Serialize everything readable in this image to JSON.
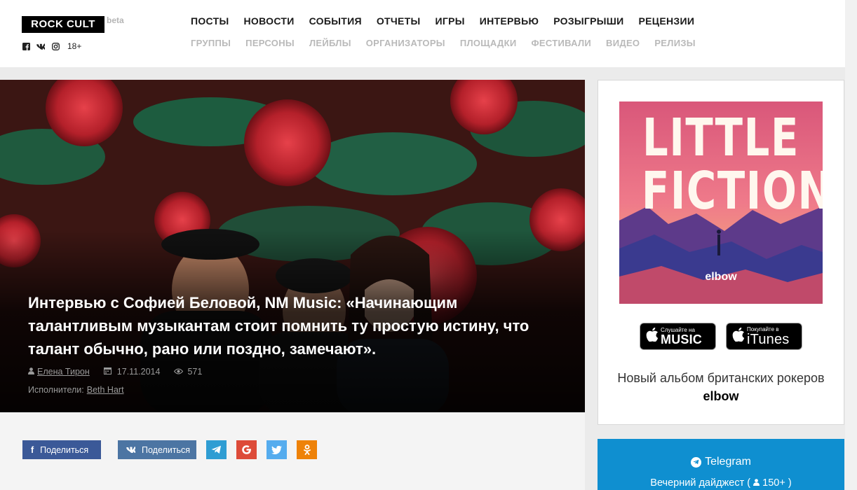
{
  "site": {
    "logo": "ROCK CULT",
    "beta": "beta",
    "age": "18+",
    "socials": [
      "facebook-icon",
      "vk-icon",
      "instagram-icon"
    ]
  },
  "nav": {
    "main": [
      "ПОСТЫ",
      "НОВОСТИ",
      "СОБЫТИЯ",
      "ОТЧЕТЫ",
      "ИГРЫ",
      "ИНТЕРВЬЮ",
      "РОЗЫГРЫШИ",
      "РЕЦЕНЗИИ"
    ],
    "sub": [
      "ГРУППЫ",
      "ПЕРСОНЫ",
      "ЛЕЙБЛЫ",
      "ОРГАНИЗАТОРЫ",
      "ПЛОЩАДКИ",
      "ФЕСТИВАЛИ",
      "ВИДЕО",
      "РЕЛИЗЫ"
    ]
  },
  "article": {
    "title": "Интервью с Софией Беловой, NM Music: «Начинающим талантливым музыкантам стоит помнить ту простую истину, что талант обычно, рано или поздно, замечают».",
    "author": "Елена Тирон",
    "date": "17.11.2014",
    "views": "571",
    "performers_label": "Исполнители:",
    "performer": "Beth Hart"
  },
  "share": {
    "fb_label": "Поделиться",
    "vk_label": "Поделиться"
  },
  "sidebar": {
    "album_title_line1": "LITTLE",
    "album_title_line2": "FICTIONS",
    "album_artist": "elbow",
    "apple_music_small": "Слушайте на",
    "apple_music_big": "MUSIC",
    "itunes_small": "Покупайте в",
    "itunes_big": "iTunes",
    "caption_prefix": "Новый альбом британских рокеров",
    "caption_bold": "elbow"
  },
  "telegram": {
    "title": "Telegram",
    "subtitle": "Вечерний дайджест (",
    "count": "150+",
    "subtitle_end": ")"
  },
  "colors": {
    "facebook": "#3b5998",
    "vk": "#4c75a3",
    "telegram": "#2f9dd3",
    "google": "#dd4b39",
    "twitter": "#55acee",
    "odnoklassniki": "#ee8208",
    "telegram_box": "#0f8fd0"
  }
}
